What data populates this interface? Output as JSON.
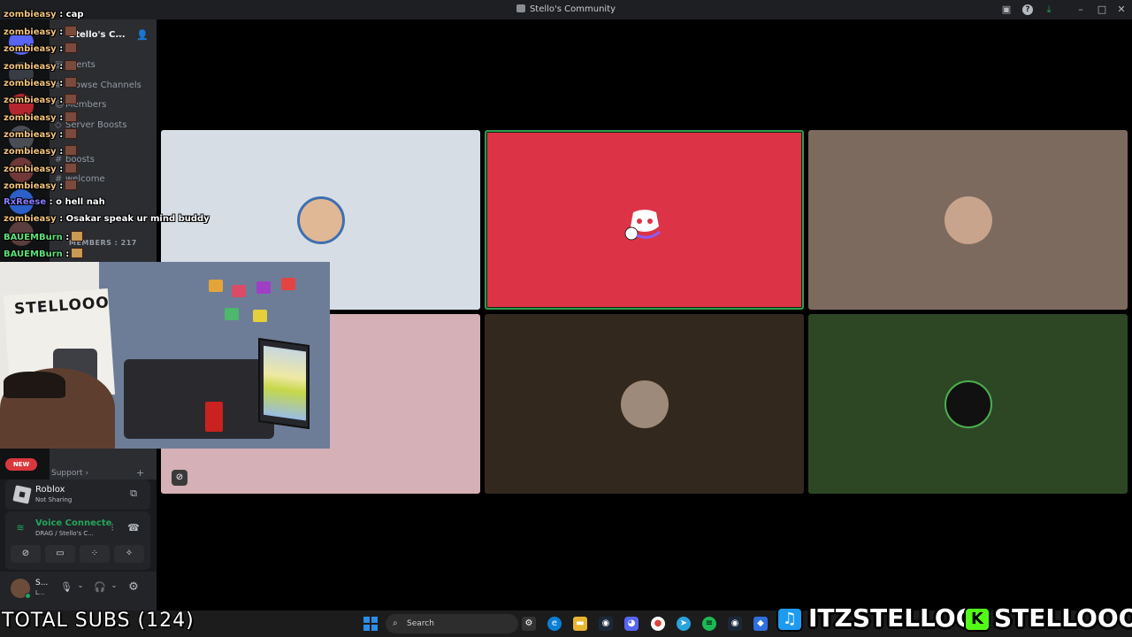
{
  "window": {
    "title": "Stello's Community"
  },
  "server": {
    "name": "Stello's C..."
  },
  "channels": [
    {
      "label": "Events"
    },
    {
      "label": "Browse Channels"
    },
    {
      "label": "Members"
    },
    {
      "label": "Server Boosts"
    },
    {
      "label": "boosts"
    },
    {
      "label": "welcome"
    }
  ],
  "categories": {
    "members_count": "MEMBERS : 217"
  },
  "chat": [
    {
      "user": "zombieasy",
      "msg": ": cap",
      "color": "#f1c27d",
      "emote": false
    },
    {
      "user": "zombieasy",
      "msg": ":",
      "color": "#f1c27d",
      "emote": true
    },
    {
      "user": "zombieasy",
      "msg": ":",
      "color": "#f1c27d",
      "emote": true
    },
    {
      "user": "zombieasy",
      "msg": ":",
      "color": "#f1c27d",
      "emote": true
    },
    {
      "user": "zombieasy",
      "msg": ":",
      "color": "#f1c27d",
      "emote": true
    },
    {
      "user": "zombieasy",
      "msg": ":",
      "color": "#f1c27d",
      "emote": true
    },
    {
      "user": "zombieasy",
      "msg": ":",
      "color": "#f1c27d",
      "emote": true
    },
    {
      "user": "zombieasy",
      "msg": ":",
      "color": "#f1c27d",
      "emote": true
    },
    {
      "user": "zombieasy",
      "msg": ":",
      "color": "#f1c27d",
      "emote": true
    },
    {
      "user": "zombieasy",
      "msg": ":",
      "color": "#f1c27d",
      "emote": true
    },
    {
      "user": "zombieasy",
      "msg": ":",
      "color": "#f1c27d",
      "emote": true
    },
    {
      "user": "RxReese",
      "msg": ": o hell nah",
      "color": "#8a7bff",
      "emote": false
    },
    {
      "user": "zombieasy",
      "msg": ": Osakar speak ur mind buddy",
      "color": "#f1c27d",
      "emote": false
    },
    {
      "user": "BAUEMBurn",
      "msg": ":",
      "color": "#5ee07a",
      "emote": true
    },
    {
      "user": "BAUEMBurn",
      "msg": ":",
      "color": "#5ee07a",
      "emote": true
    }
  ],
  "tiles": [
    {
      "bg": "#d7dde4"
    },
    {
      "bg": "#dd3347"
    },
    {
      "bg": "#7c6a5f"
    },
    {
      "bg": "#d5b0b6"
    },
    {
      "bg": "#33281d"
    },
    {
      "bg": "#2d4725"
    }
  ],
  "webcam": {
    "banner_text": "STELLOOO"
  },
  "sidebar_bottom": {
    "new_badge": "NEW",
    "support_label": "Support",
    "activity_title": "Roblox",
    "activity_sub": "Not Sharing",
    "voice_status": "Voice Connecte",
    "voice_channel": "DRAG / Stello's C...",
    "user_name": "S...",
    "user_sub": "L..."
  },
  "taskbar": {
    "search_placeholder": "Search"
  },
  "overlay": {
    "total_subs": "TOTAL SUBS (124)",
    "twitter_handle": "ITZSTELLOO",
    "kick_handle": "STELLOOO"
  },
  "colors": {
    "discord_blurple": "#5865f2",
    "voice_green": "#23a55a",
    "twitter_blue": "#1d9bf0",
    "kick_green": "#53fc18"
  }
}
